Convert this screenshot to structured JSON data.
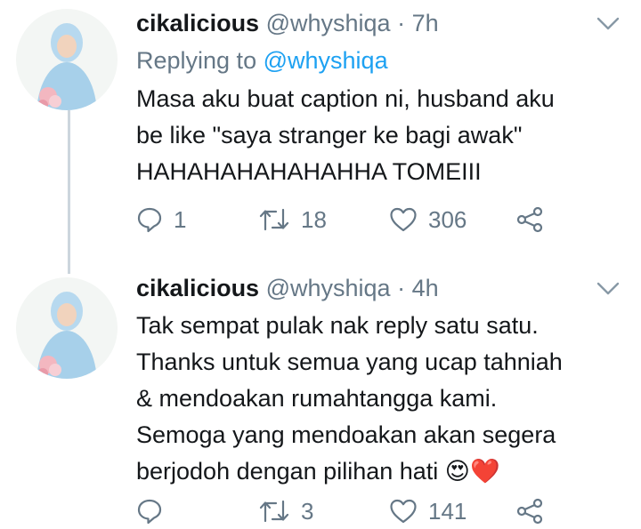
{
  "tweets": [
    {
      "name": "cikalicious",
      "handle": "@whyshiqa",
      "time": "7h",
      "reply_prefix": "Replying to",
      "reply_mention": "@whyshiqa",
      "lines": [
        "Masa aku buat caption ni, husband aku",
        "be like \"saya stranger ke bagi awak\"",
        "HAHAHAHAHAHAHHA TOMEIII"
      ],
      "replies": "1",
      "retweets": "18",
      "likes": "306"
    },
    {
      "name": "cikalicious",
      "handle": "@whyshiqa",
      "time": "4h",
      "lines": [
        "Tak sempat pulak nak reply satu satu.",
        "Thanks untuk semua yang ucap tahniah",
        "& mendoakan rumahtangga kami.",
        "Semoga yang mendoakan akan segera",
        "berjodoh dengan pilihan hati"
      ],
      "emojis": [
        "😍",
        "❤️"
      ],
      "replies": "",
      "retweets": "3",
      "likes": "141"
    }
  ],
  "icons": {
    "reply": "reply-icon",
    "retweet": "retweet-icon",
    "like": "heart-icon",
    "share": "share-icon",
    "caret": "chevron-down-icon"
  },
  "colors": {
    "text": "#14171a",
    "secondary": "#657786",
    "link": "#1da1f2",
    "thread_line": "#ccd6dd"
  }
}
